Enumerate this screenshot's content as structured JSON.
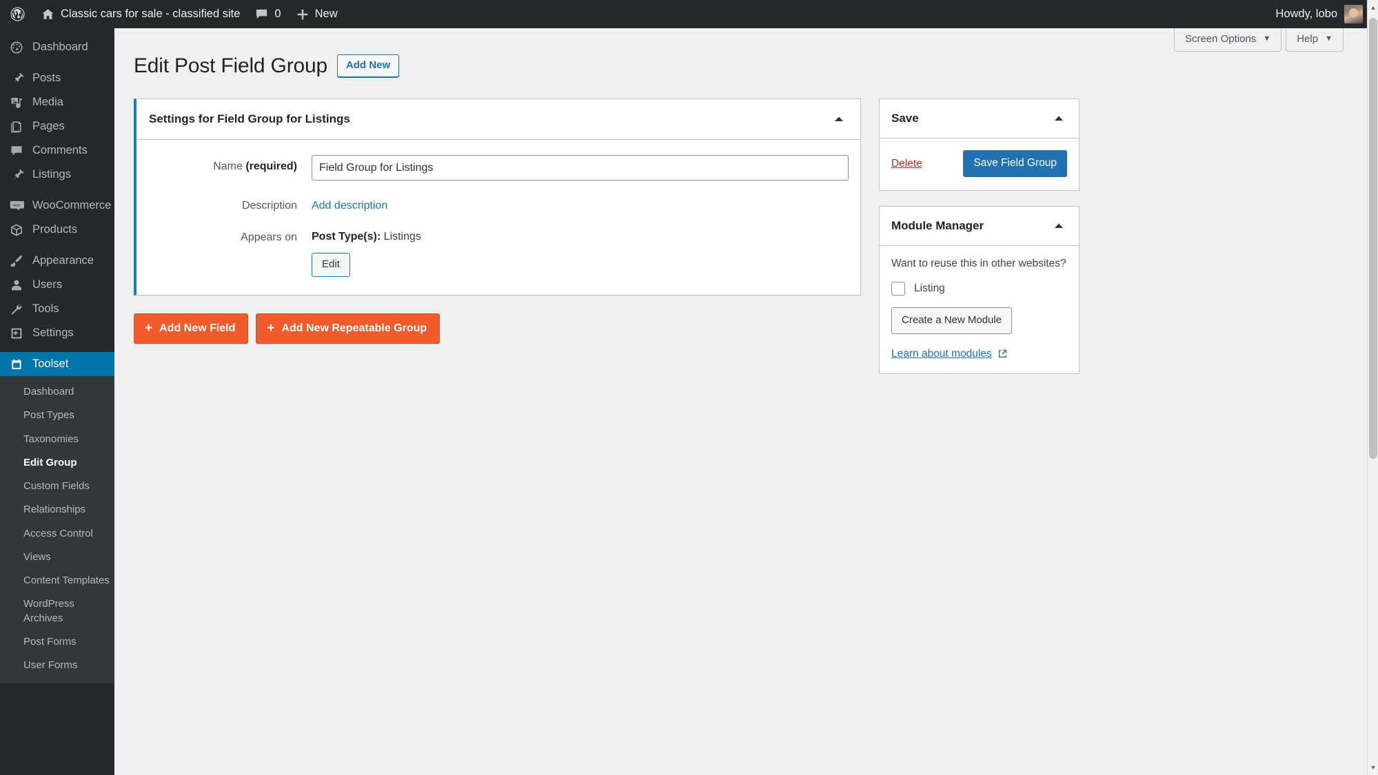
{
  "adminbar": {
    "wp_logo": "wordpress-logo",
    "site_name": "Classic cars for sale - classified site",
    "comments_count": "0",
    "new_label": "New",
    "howdy": "Howdy, lobo"
  },
  "sidebar": {
    "top_items": [
      {
        "label": "Dashboard",
        "icon": "dashboard-icon"
      },
      {
        "label": "Posts",
        "icon": "pin-icon"
      },
      {
        "label": "Media",
        "icon": "media-icon"
      },
      {
        "label": "Pages",
        "icon": "pages-icon"
      },
      {
        "label": "Comments",
        "icon": "comments-icon"
      },
      {
        "label": "Listings",
        "icon": "pin-icon"
      },
      {
        "label": "WooCommerce",
        "icon": "woocommerce-icon"
      },
      {
        "label": "Products",
        "icon": "products-icon"
      },
      {
        "label": "Appearance",
        "icon": "brush-icon"
      },
      {
        "label": "Users",
        "icon": "user-icon"
      },
      {
        "label": "Tools",
        "icon": "wrench-icon"
      },
      {
        "label": "Settings",
        "icon": "settings-icon"
      },
      {
        "label": "Toolset",
        "icon": "toolset-icon"
      }
    ],
    "submenu": [
      {
        "label": "Dashboard"
      },
      {
        "label": "Post Types"
      },
      {
        "label": "Taxonomies"
      },
      {
        "label": "Edit Group"
      },
      {
        "label": "Custom Fields"
      },
      {
        "label": "Relationships"
      },
      {
        "label": "Access Control"
      },
      {
        "label": "Views"
      },
      {
        "label": "Content Templates"
      },
      {
        "label": "WordPress Archives"
      },
      {
        "label": "Post Forms"
      },
      {
        "label": "User Forms"
      }
    ],
    "current_top": "Toolset",
    "current_sub": "Edit Group"
  },
  "screen_meta": {
    "screen_options": "Screen Options",
    "help": "Help"
  },
  "page": {
    "title": "Edit Post Field Group",
    "add_new": "Add New"
  },
  "settings_box": {
    "title": "Settings for Field Group for Listings",
    "name_label_text": "Name ",
    "name_label_required": "(required)",
    "name_value": "Field Group for Listings",
    "description_label": "Description",
    "description_link": "Add description",
    "appears_on_label": "Appears on",
    "appears_on_prefix": "Post Type(s):",
    "appears_on_value": "Listings",
    "edit_button": "Edit"
  },
  "actions": {
    "add_new_field": "Add New Field",
    "add_new_repeatable_group": "Add New Repeatable Group",
    "plus": "+"
  },
  "save_box": {
    "title": "Save",
    "delete": "Delete",
    "save_button": "Save Field Group"
  },
  "module_manager": {
    "title": "Module Manager",
    "question": "Want to reuse this in other websites?",
    "checkbox_label": "Listing",
    "checkbox_checked": false,
    "create_button": "Create a New Module",
    "learn_link": "Learn about modules"
  },
  "colors": {
    "admin_bar": "#23282d",
    "sidebar": "#23282d",
    "submenu": "#32373c",
    "current_highlight": "#0073aa",
    "accent_border": "#0c87b8",
    "orange_button": "#f15a2b",
    "primary_button": "#2271b1",
    "link": "#2271b1",
    "delete": "#b32d2e",
    "page_bg": "#f0f0f1"
  }
}
